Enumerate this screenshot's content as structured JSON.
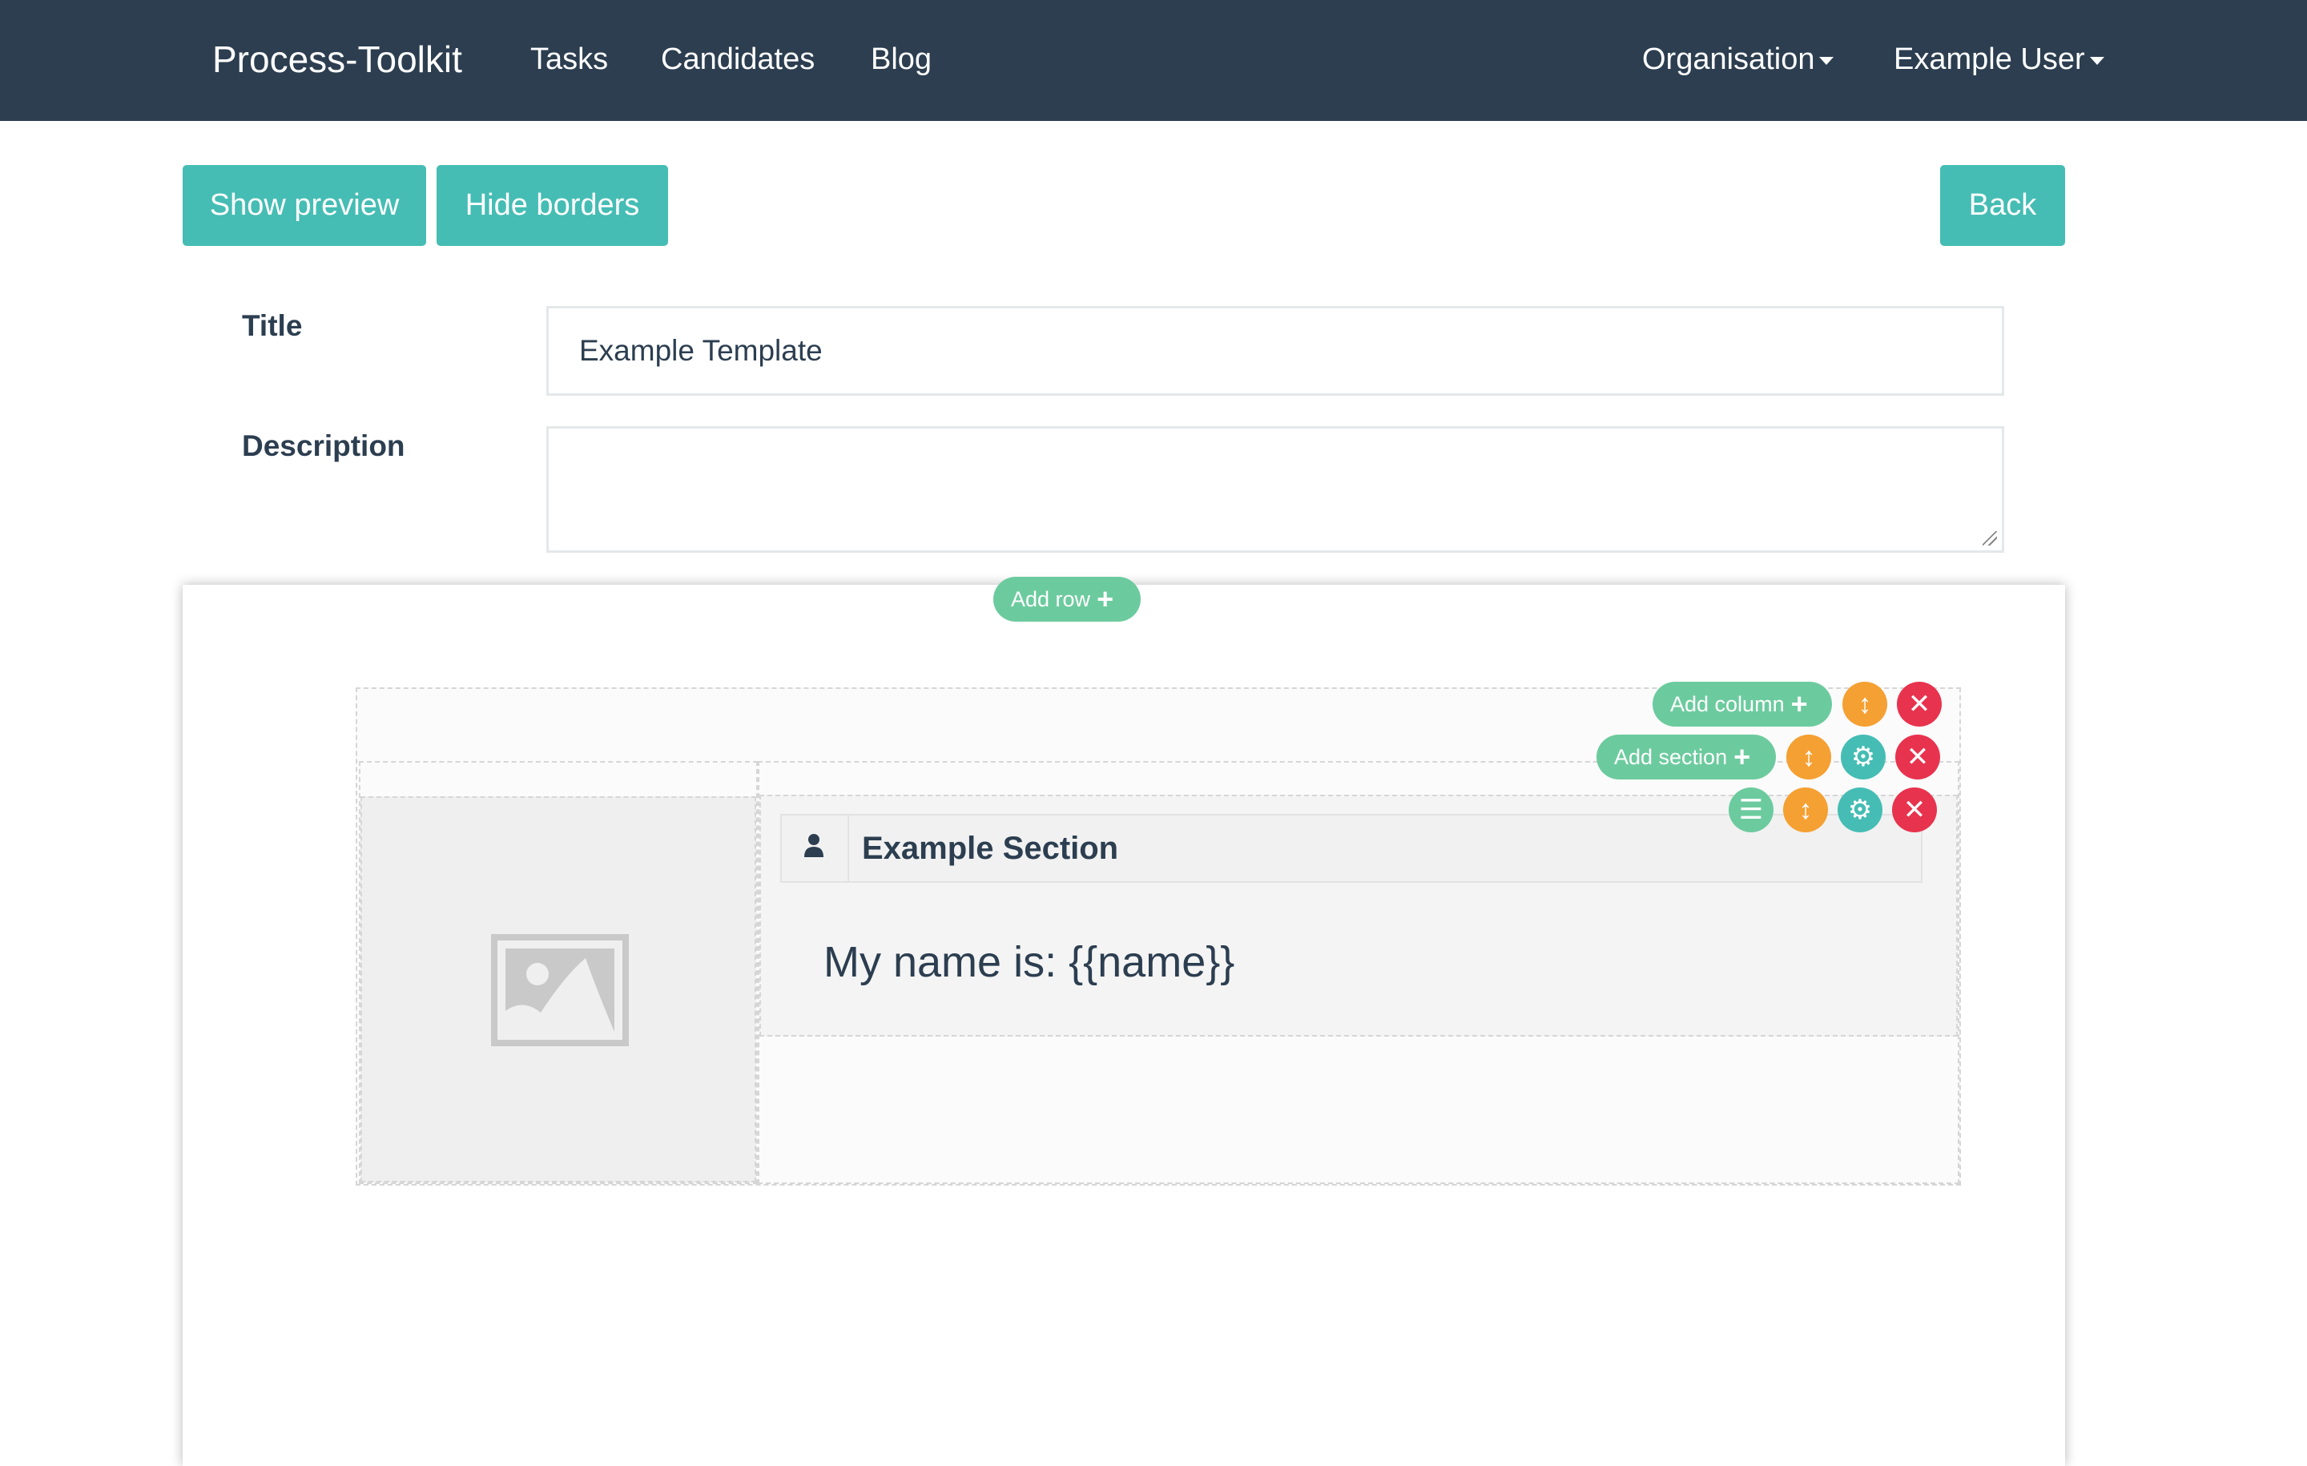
{
  "navbar": {
    "brand": "Process-Toolkit",
    "links": [
      "Tasks",
      "Candidates",
      "Blog"
    ],
    "organisation": "Organisation",
    "user": "Example User"
  },
  "toolbar": {
    "show_preview": "Show preview",
    "hide_borders": "Hide borders",
    "back": "Back"
  },
  "form": {
    "title_label": "Title",
    "title_value": "Example Template",
    "description_label": "Description",
    "description_value": ""
  },
  "editor": {
    "add_row": "Add row",
    "add_column": "Add column",
    "add_section": "Add section",
    "section_title": "Example Section",
    "section_body": "My name is: {{name}}"
  },
  "colors": {
    "navbar": "#2c3e50",
    "primary": "#45bdb4",
    "add_green": "#6ccb9e",
    "move_orange": "#f5a033",
    "delete_red": "#e8334e"
  }
}
